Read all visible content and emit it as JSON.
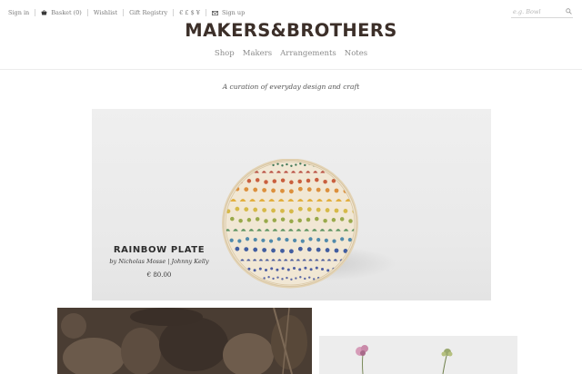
{
  "topbar": {
    "sign_in": "Sign in",
    "basket_label": "Basket",
    "basket_count": "(0)",
    "wishlist": "Wishlist",
    "gift_registry": "Gift Registry",
    "currencies": "€ £ $ ¥",
    "sign_up": "Sign up"
  },
  "search": {
    "placeholder": "e.g. Bowl"
  },
  "brand": {
    "logo": "MAKERS&BROTHERS"
  },
  "nav": {
    "items": [
      "Shop",
      "Makers",
      "Arrangements",
      "Notes"
    ]
  },
  "tagline": "A curation of everyday design and craft",
  "hero": {
    "title": "RAINBOW PLATE",
    "byline": "by Nicholas Mosse | Johnny Kelly",
    "price": "€ 80.00"
  },
  "icons": {
    "basket": "basket-icon",
    "mail": "mail-icon",
    "search": "search-icon"
  },
  "colors": {
    "logo": "#3c2f29",
    "text": "#555555",
    "hero_bg": "#ebebeb"
  }
}
